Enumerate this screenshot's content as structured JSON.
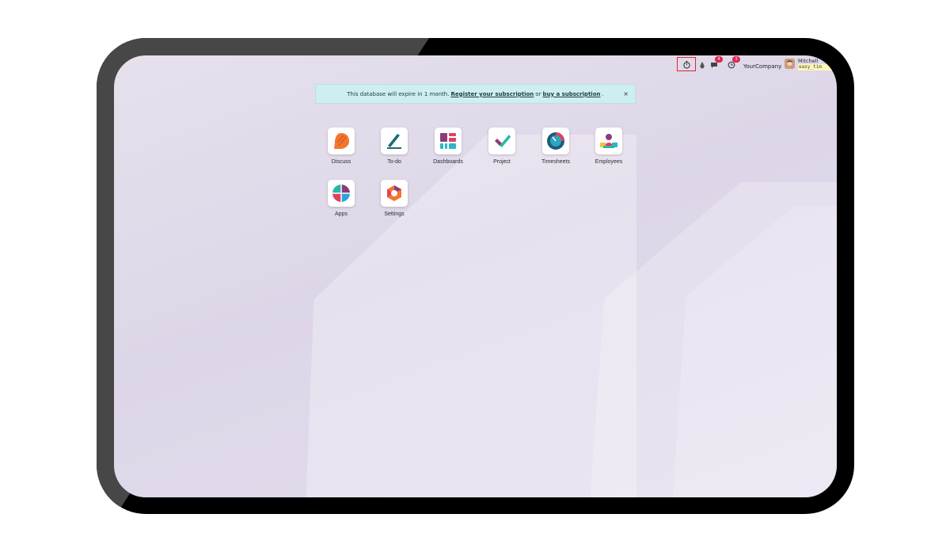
{
  "navbar": {
    "timer_icon": "stopwatch-icon",
    "bug_icon": "bug-icon",
    "messages_icon": "chat-icon",
    "messages_count": "4",
    "activity_icon": "clock-icon",
    "activity_count": "3",
    "company": "YourCompany",
    "user_name": "Mitchell",
    "user_db": "easy_tim"
  },
  "banner": {
    "prefix": "This database will expire in 1 month.",
    "register_link": "Register your subscription",
    "middle": "or",
    "buy_link": "buy a subscription",
    "suffix": ".",
    "close": "×"
  },
  "apps": [
    {
      "label": "Discuss",
      "icon": "discuss-icon"
    },
    {
      "label": "To-do",
      "icon": "todo-icon"
    },
    {
      "label": "Dashboards",
      "icon": "dashboards-icon"
    },
    {
      "label": "Project",
      "icon": "project-icon"
    },
    {
      "label": "Timesheets",
      "icon": "timesheets-icon"
    },
    {
      "label": "Employees",
      "icon": "employees-icon"
    },
    {
      "label": "Apps",
      "icon": "apps-icon"
    },
    {
      "label": "Settings",
      "icon": "settings-icon"
    }
  ],
  "colors": {
    "banner_bg": "#cdeff1",
    "highlight": "#e0262a",
    "badge": "#e0264f"
  }
}
